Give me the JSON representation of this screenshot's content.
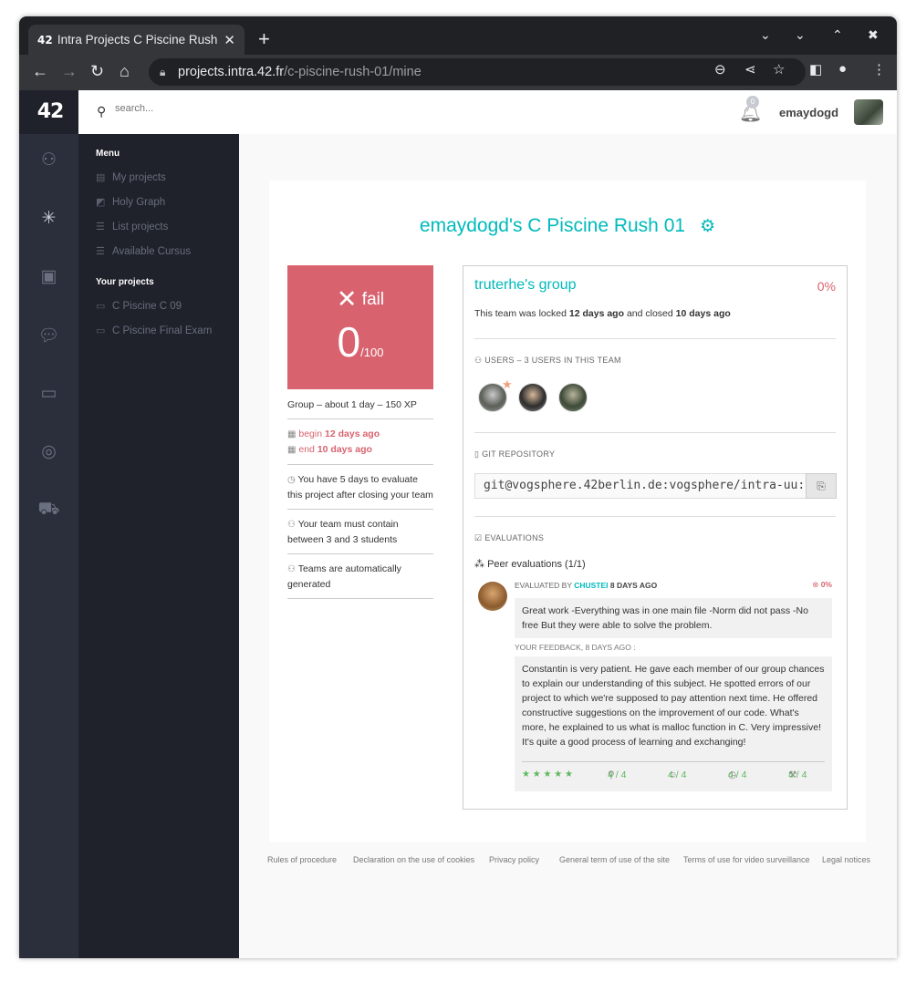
{
  "browser": {
    "tab_title": "Intra Projects C Piscine Rush 01",
    "tab_favicon": "42",
    "url_host": "projects.intra.42.fr",
    "url_path": "/c-piscine-rush-01/mine"
  },
  "topbar": {
    "search_placeholder": "search...",
    "notifications_count": "0",
    "username": "emaydogd"
  },
  "logo": "42",
  "menu": {
    "heading": "Menu",
    "items": [
      {
        "label": "My projects"
      },
      {
        "label": "Holy Graph"
      },
      {
        "label": "List projects"
      },
      {
        "label": "Available Cursus"
      }
    ],
    "your_projects_heading": "Your projects",
    "projects": [
      {
        "label": "C Piscine C 09"
      },
      {
        "label": "C Piscine Final Exam"
      }
    ]
  },
  "project": {
    "title": "emaydogd's C Piscine Rush 01",
    "status": "fail",
    "score": "0",
    "score_max": "/100",
    "summary": "Group – about 1 day – 150 XP",
    "begin_label": "begin",
    "begin_value": "12 days ago",
    "end_label": "end",
    "end_value": "10 days ago",
    "evaluate_note": "You have 5 days to evaluate this project after closing your team",
    "team_note": "Your team must contain between 3 and 3 students",
    "generated_note": "Teams are automatically generated"
  },
  "team": {
    "name": "truterhe's group",
    "percent": "0%",
    "locked_prefix": "This team was locked",
    "locked_when": "12 days ago",
    "closed_prefix": "and closed",
    "closed_when": "10 days ago",
    "users_heading": "USERS – 3 USERS IN THIS TEAM",
    "git_heading": "GIT REPOSITORY",
    "git_url": "git@vogsphere.42berlin.de:vogsphere/intra-uu:",
    "evaluations_heading": "EVALUATIONS",
    "peer_label": "Peer evaluations (1/1)"
  },
  "evaluation": {
    "by_prefix": "EVALUATED BY",
    "evaluator": "CHUSTEI",
    "when": "8 DAYS AGO",
    "percent": "0%",
    "comment": "Great work -Everything was in one main file -Norm did not pass -No free But they were able to solve the problem.",
    "feedback_label": "YOUR FEEDBACK, 8 DAYS AGO :",
    "feedback": "Constantin is very patient. He gave each member of our group chances to explain our understanding of this subject. He spotted errors of our project to which we're supposed to pay attention next time. He offered constructive suggestions on the improvement of our code. What's more, he explained to us what is malloc function in C. Very impressive! It's quite a good process of learning and exchanging!",
    "stars": "★ ★ ★ ★ ★",
    "scores": [
      "4 / 4",
      "4 / 4",
      "4 / 4",
      "4 / 4"
    ]
  },
  "footer": [
    "Rules of procedure",
    "Declaration on the use of cookies",
    "Privacy policy",
    "General term of use of the site",
    "Terms of use for video surveillance",
    "Legal notices"
  ],
  "colors": {
    "accent": "#00babc",
    "fail": "#d8636f",
    "sidebar": "#1f222b",
    "success": "#5cb85c"
  }
}
